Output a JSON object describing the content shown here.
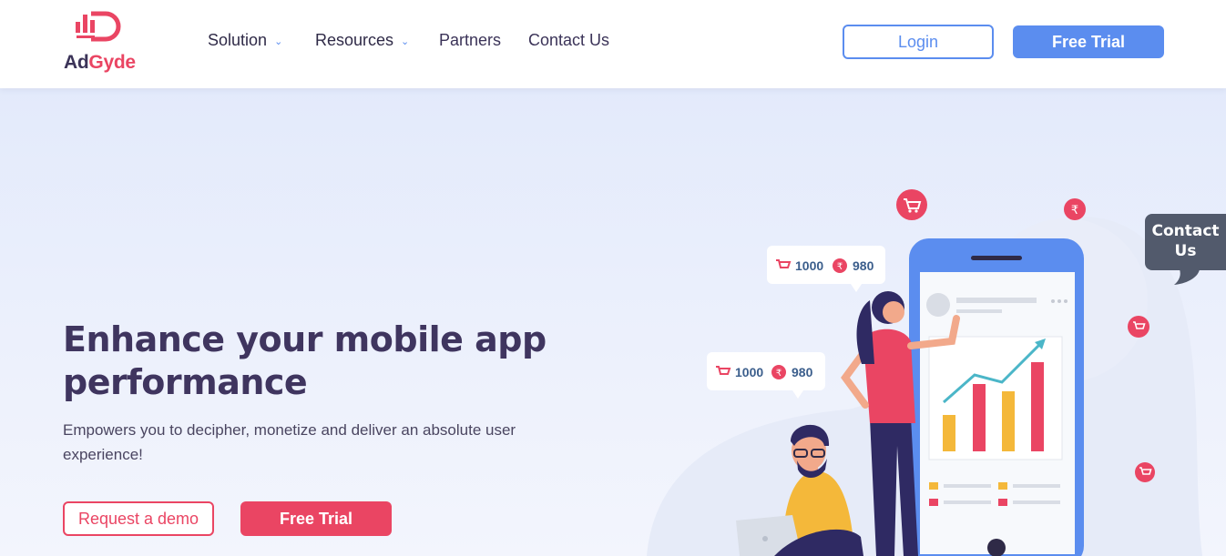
{
  "brand": {
    "name_part1": "Ad",
    "name_part2": "Gyde",
    "logo_icon": "adgyde-logo-icon",
    "color_primary": "#ea4563",
    "color_dark": "#3b3358"
  },
  "nav": {
    "items": [
      {
        "label": "Solution",
        "has_dropdown": true
      },
      {
        "label": "Resources",
        "has_dropdown": true
      },
      {
        "label": "Partners",
        "has_dropdown": false
      },
      {
        "label": "Contact Us",
        "has_dropdown": false
      }
    ],
    "login_label": "Login",
    "free_trial_label": "Free Trial",
    "accent_color": "#5b8def"
  },
  "hero": {
    "title_line1": "Enhance your mobile app",
    "title_line2": "performance",
    "subtitle": "Empowers you to decipher, monetize and deliver an absolute user experience!",
    "demo_label": "Request a demo",
    "trial_label": "Free Trial",
    "badges": [
      {
        "cart_value": "1000",
        "rupee_value": "980"
      },
      {
        "cart_value": "1000",
        "rupee_value": "980"
      }
    ]
  },
  "contact_tab": {
    "line1": "Contact",
    "line2": "Us"
  }
}
